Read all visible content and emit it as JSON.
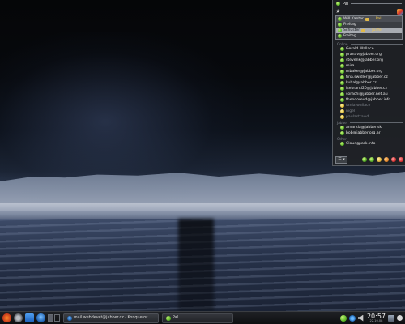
{
  "widget": {
    "title": "Pal",
    "accounts": [
      {
        "label": "Will Kanter",
        "value": "Pal"
      },
      {
        "label": "Freitag",
        "value": ""
      },
      {
        "label": "Schuster",
        "value": "Juiffe"
      },
      {
        "label": "Freitag",
        "value": ""
      }
    ],
    "groups": [
      {
        "header": "Online",
        "contacts": [
          {
            "name": "Gerald Wallace",
            "status": "online"
          },
          {
            "name": "pranav@jabber.org",
            "status": "online"
          },
          {
            "name": "stevenk@jabber.org",
            "status": "online"
          },
          {
            "name": "mira",
            "status": "online"
          },
          {
            "name": "mbaker@jabber.org",
            "status": "online"
          },
          {
            "name": "tina.swidler@jabber.cz",
            "status": "online"
          },
          {
            "name": "kubal@jabber.cz",
            "status": "online"
          },
          {
            "name": "isebrand20@jabber.cz",
            "status": "online"
          },
          {
            "name": "sorachi@jabber.net.au",
            "status": "online"
          },
          {
            "name": "theodorevd@jabber.info",
            "status": "online"
          },
          {
            "name": "tania.wallace",
            "status": "away"
          },
          {
            "name": "nigel",
            "status": "away"
          },
          {
            "name": "paulastrawd",
            "status": "away"
          }
        ]
      },
      {
        "header": "Jabber",
        "contacts": [
          {
            "name": "amanda@jabber.sk",
            "status": "online"
          },
          {
            "name": "bob@jabber.org.ar",
            "status": "online"
          }
        ]
      },
      {
        "header": "Other",
        "contacts": [
          {
            "name": "Cloudgpark.info",
            "status": "online"
          }
        ]
      }
    ],
    "status_dropdown": "☰ ▾",
    "status_buttons": [
      "online",
      "away",
      "busy",
      "offline",
      "invisible",
      "disconnect"
    ]
  },
  "taskbar": {
    "task1": "mail.webdevet@jabber.cz - Konqueror",
    "task2": "Pal",
    "clock_time": "20:57",
    "clock_date": "22.10.08"
  }
}
